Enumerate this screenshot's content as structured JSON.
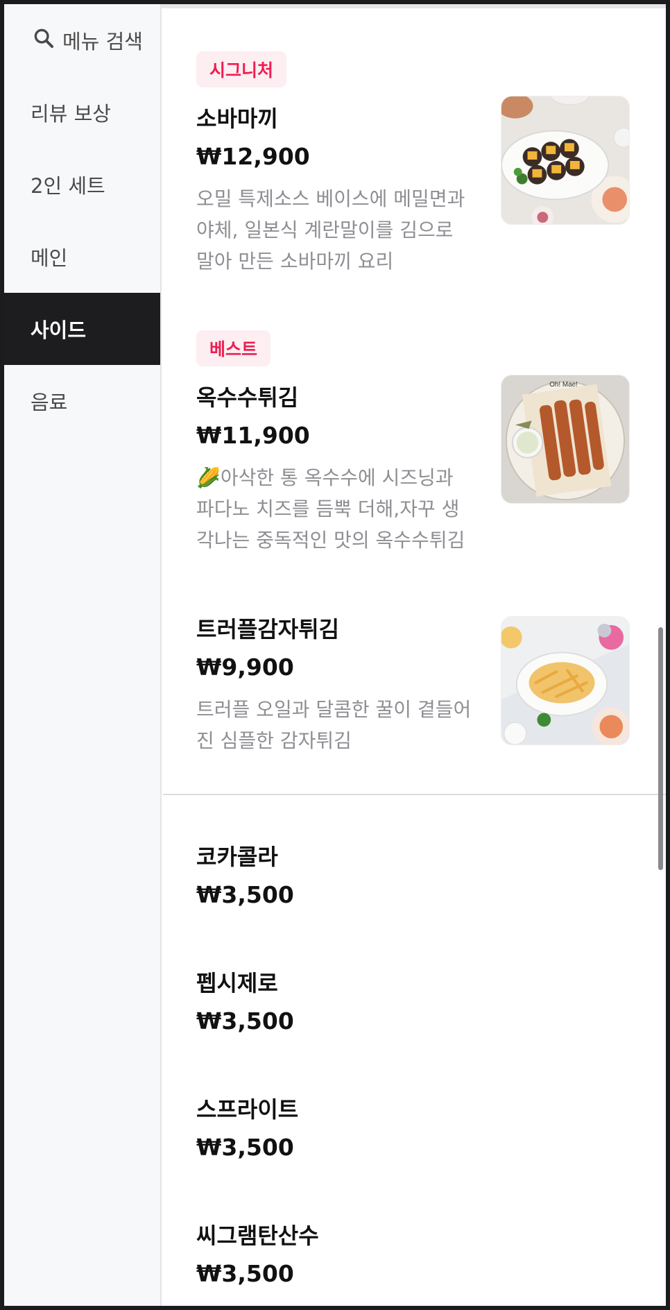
{
  "sidebar": {
    "search_label": "메뉴 검색",
    "items": [
      {
        "label": "리뷰 보상",
        "active": false
      },
      {
        "label": "2인 세트",
        "active": false
      },
      {
        "label": "메인",
        "active": false
      },
      {
        "label": "사이드",
        "active": true
      },
      {
        "label": "음료",
        "active": false
      }
    ]
  },
  "menu": {
    "side": [
      {
        "badge": "시그니처",
        "name": "소바마끼",
        "price": "₩12,900",
        "description": "오밀 특제소스 베이스에 메밀면과 야체, 일본식 계란말이를 김으로 말아 만든 소바마끼 요리",
        "image": "sobamaki-photo"
      },
      {
        "badge": "베스트",
        "name": "옥수수튀김",
        "price": "₩11,900",
        "description": "🌽아삭한 통 옥수수에 시즈닝과 파다노 치즈를 듬뿍 더해,자꾸 생각나는 중독적인 맛의 옥수수튀김",
        "image": "corn-fry-photo"
      },
      {
        "badge": "",
        "name": "트러플감자튀김",
        "price": "₩9,900",
        "description": "트러플 오일과 달콤한 꿀이 곁들어진 심플한 감자튀김",
        "image": "truffle-fries-photo"
      }
    ],
    "drinks": [
      {
        "name": "코카콜라",
        "price": "₩3,500"
      },
      {
        "name": "펩시제로",
        "price": "₩3,500"
      },
      {
        "name": "스프라이트",
        "price": "₩3,500"
      },
      {
        "name": "씨그램탄산수",
        "price": "₩3,500"
      }
    ]
  },
  "colors": {
    "accent": "#ee1d52",
    "badge_bg": "#fdeef1",
    "active_nav": "#1d1d1f"
  }
}
